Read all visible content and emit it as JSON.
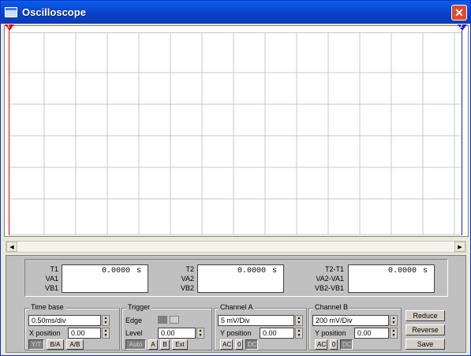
{
  "window": {
    "title": "Oscilloscope",
    "close_label": "✕"
  },
  "markers": {
    "cursor1": "1",
    "cursor2": "2"
  },
  "measurements": {
    "group1": {
      "labels": [
        "T1",
        "VA1",
        "VB1"
      ],
      "value": "0.0000",
      "unit": "s"
    },
    "group2": {
      "labels": [
        "T2",
        "VA2",
        "VB2"
      ],
      "value": "0.0000",
      "unit": "s"
    },
    "group3": {
      "labels": [
        "T2-T1",
        "VA2-VA1",
        "VB2-VB1"
      ],
      "value": "0.0000",
      "unit": "s"
    }
  },
  "timebase": {
    "legend": "Time base",
    "scale": "0.50ms/div",
    "xpos_label": "X position",
    "xpos_value": "0.00",
    "buttons": [
      "Y/T",
      "B/A",
      "A/B"
    ]
  },
  "trigger": {
    "legend": "Trigger",
    "edge_label": "Edge",
    "level_label": "Level",
    "level_value": "0.00",
    "buttons": [
      "Auto",
      "A",
      "B",
      "Ext"
    ]
  },
  "channel_a": {
    "legend": "Channel A",
    "scale": "5 mV/Div",
    "ypos_label": "Y position",
    "ypos_value": "0.00",
    "buttons": [
      "AC",
      "0",
      "DC"
    ]
  },
  "channel_b": {
    "legend": "Channel B",
    "scale": "200 mV/Div",
    "ypos_label": "Y position",
    "ypos_value": "0.00",
    "buttons": [
      "AC",
      "0",
      "DC"
    ]
  },
  "side_buttons": {
    "reduce": "Reduce",
    "reverse": "Reverse",
    "save": "Save"
  },
  "scroll": {
    "left_arrow": "◀",
    "right_arrow": "▶"
  }
}
